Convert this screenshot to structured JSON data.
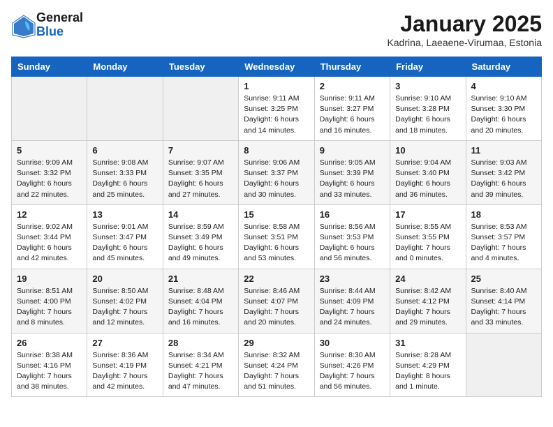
{
  "header": {
    "logo_line1": "General",
    "logo_line2": "Blue",
    "month_title": "January 2025",
    "location": "Kadrina, Laeaene-Virumaa, Estonia"
  },
  "days_of_week": [
    "Sunday",
    "Monday",
    "Tuesday",
    "Wednesday",
    "Thursday",
    "Friday",
    "Saturday"
  ],
  "weeks": [
    [
      {
        "day": "",
        "content": ""
      },
      {
        "day": "",
        "content": ""
      },
      {
        "day": "",
        "content": ""
      },
      {
        "day": "1",
        "content": "Sunrise: 9:11 AM\nSunset: 3:25 PM\nDaylight: 6 hours and 14 minutes."
      },
      {
        "day": "2",
        "content": "Sunrise: 9:11 AM\nSunset: 3:27 PM\nDaylight: 6 hours and 16 minutes."
      },
      {
        "day": "3",
        "content": "Sunrise: 9:10 AM\nSunset: 3:28 PM\nDaylight: 6 hours and 18 minutes."
      },
      {
        "day": "4",
        "content": "Sunrise: 9:10 AM\nSunset: 3:30 PM\nDaylight: 6 hours and 20 minutes."
      }
    ],
    [
      {
        "day": "5",
        "content": "Sunrise: 9:09 AM\nSunset: 3:32 PM\nDaylight: 6 hours and 22 minutes."
      },
      {
        "day": "6",
        "content": "Sunrise: 9:08 AM\nSunset: 3:33 PM\nDaylight: 6 hours and 25 minutes."
      },
      {
        "day": "7",
        "content": "Sunrise: 9:07 AM\nSunset: 3:35 PM\nDaylight: 6 hours and 27 minutes."
      },
      {
        "day": "8",
        "content": "Sunrise: 9:06 AM\nSunset: 3:37 PM\nDaylight: 6 hours and 30 minutes."
      },
      {
        "day": "9",
        "content": "Sunrise: 9:05 AM\nSunset: 3:39 PM\nDaylight: 6 hours and 33 minutes."
      },
      {
        "day": "10",
        "content": "Sunrise: 9:04 AM\nSunset: 3:40 PM\nDaylight: 6 hours and 36 minutes."
      },
      {
        "day": "11",
        "content": "Sunrise: 9:03 AM\nSunset: 3:42 PM\nDaylight: 6 hours and 39 minutes."
      }
    ],
    [
      {
        "day": "12",
        "content": "Sunrise: 9:02 AM\nSunset: 3:44 PM\nDaylight: 6 hours and 42 minutes."
      },
      {
        "day": "13",
        "content": "Sunrise: 9:01 AM\nSunset: 3:47 PM\nDaylight: 6 hours and 45 minutes."
      },
      {
        "day": "14",
        "content": "Sunrise: 8:59 AM\nSunset: 3:49 PM\nDaylight: 6 hours and 49 minutes."
      },
      {
        "day": "15",
        "content": "Sunrise: 8:58 AM\nSunset: 3:51 PM\nDaylight: 6 hours and 53 minutes."
      },
      {
        "day": "16",
        "content": "Sunrise: 8:56 AM\nSunset: 3:53 PM\nDaylight: 6 hours and 56 minutes."
      },
      {
        "day": "17",
        "content": "Sunrise: 8:55 AM\nSunset: 3:55 PM\nDaylight: 7 hours and 0 minutes."
      },
      {
        "day": "18",
        "content": "Sunrise: 8:53 AM\nSunset: 3:57 PM\nDaylight: 7 hours and 4 minutes."
      }
    ],
    [
      {
        "day": "19",
        "content": "Sunrise: 8:51 AM\nSunset: 4:00 PM\nDaylight: 7 hours and 8 minutes."
      },
      {
        "day": "20",
        "content": "Sunrise: 8:50 AM\nSunset: 4:02 PM\nDaylight: 7 hours and 12 minutes."
      },
      {
        "day": "21",
        "content": "Sunrise: 8:48 AM\nSunset: 4:04 PM\nDaylight: 7 hours and 16 minutes."
      },
      {
        "day": "22",
        "content": "Sunrise: 8:46 AM\nSunset: 4:07 PM\nDaylight: 7 hours and 20 minutes."
      },
      {
        "day": "23",
        "content": "Sunrise: 8:44 AM\nSunset: 4:09 PM\nDaylight: 7 hours and 24 minutes."
      },
      {
        "day": "24",
        "content": "Sunrise: 8:42 AM\nSunset: 4:12 PM\nDaylight: 7 hours and 29 minutes."
      },
      {
        "day": "25",
        "content": "Sunrise: 8:40 AM\nSunset: 4:14 PM\nDaylight: 7 hours and 33 minutes."
      }
    ],
    [
      {
        "day": "26",
        "content": "Sunrise: 8:38 AM\nSunset: 4:16 PM\nDaylight: 7 hours and 38 minutes."
      },
      {
        "day": "27",
        "content": "Sunrise: 8:36 AM\nSunset: 4:19 PM\nDaylight: 7 hours and 42 minutes."
      },
      {
        "day": "28",
        "content": "Sunrise: 8:34 AM\nSunset: 4:21 PM\nDaylight: 7 hours and 47 minutes."
      },
      {
        "day": "29",
        "content": "Sunrise: 8:32 AM\nSunset: 4:24 PM\nDaylight: 7 hours and 51 minutes."
      },
      {
        "day": "30",
        "content": "Sunrise: 8:30 AM\nSunset: 4:26 PM\nDaylight: 7 hours and 56 minutes."
      },
      {
        "day": "31",
        "content": "Sunrise: 8:28 AM\nSunset: 4:29 PM\nDaylight: 8 hours and 1 minute."
      },
      {
        "day": "",
        "content": ""
      }
    ]
  ]
}
